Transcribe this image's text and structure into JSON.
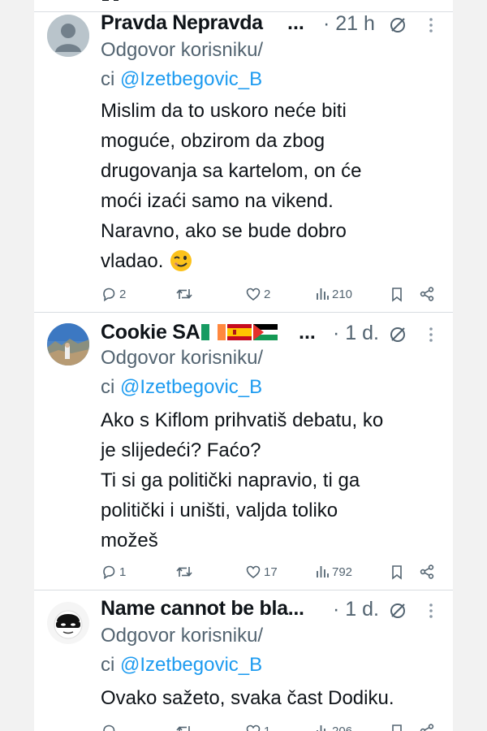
{
  "tweets": [
    {
      "name": "Pravda Nepravda",
      "ellipsis": "...",
      "time": "· 21 h",
      "reply_prefix": "Odgovor korisniku/",
      "reply_ci": "ci",
      "reply_handle": "@Izetbegovic_B",
      "body_lines": [
        "Mislim da to uskoro neće biti",
        "moguće, obzirom da zbog",
        "drugovanja sa kartelom, on će",
        "moći izaći samo na vikend.",
        "Naravno, ako se bude dobro",
        "vladao."
      ],
      "emoji": "😉",
      "replies": "2",
      "reposts": "",
      "likes": "2",
      "views": "210"
    },
    {
      "name": "Cookie SA",
      "flags": [
        "ireland",
        "spain",
        "palestine"
      ],
      "ellipsis": "...",
      "time": "· 1 d.",
      "reply_prefix": "Odgovor korisniku/",
      "reply_ci": "ci",
      "reply_handle": "@Izetbegovic_B",
      "body_lines": [
        "Ako s Kiflom prihvatiš debatu,  ko",
        "je slijedeći? Faćo?",
        "Ti si ga politički napravio, ti ga",
        "politički i uništi, valjda toliko",
        "možeš"
      ],
      "replies": "1",
      "reposts": "",
      "likes": "17",
      "views": "792"
    },
    {
      "name": "Name cannot be bla...",
      "time": "· 1 d.",
      "reply_prefix": "Odgovor korisniku/",
      "reply_ci": "ci",
      "reply_handle": "@Izetbegovic_B",
      "body_lines": [
        "Ovako sažeto, svaka čast Dodiku."
      ],
      "replies": "",
      "reposts": "",
      "likes": "1",
      "views": "206"
    }
  ],
  "colors": {
    "text": "#0f1419",
    "secondary": "#536471",
    "link": "#1d9bf0",
    "divider": "#d9dde1"
  },
  "icons": [
    "reply-icon",
    "repost-icon",
    "like-icon",
    "views-icon",
    "bookmark-icon",
    "share-icon",
    "grok-icon",
    "more-icon"
  ]
}
